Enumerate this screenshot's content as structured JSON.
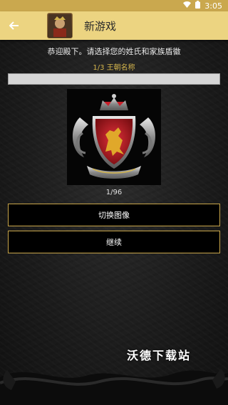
{
  "status_bar": {
    "time": "3:05"
  },
  "app_bar": {
    "title": "新游戏"
  },
  "welcome_text": "恭迎殿下。请选择您的姓氏和家族盾徽",
  "step_label": "1/3 王朝名称",
  "name_field": {
    "value": "",
    "placeholder": ""
  },
  "crest": {
    "index_label": "1/96"
  },
  "buttons": {
    "switch_image": "切换图像",
    "continue": "继续"
  },
  "watermark": "沃德下载站",
  "colors": {
    "status_bar": "#caa84e",
    "app_bar": "#ecd481",
    "accent_gold": "#d4b54c",
    "crest_red": "#c8202a"
  },
  "icons": [
    "wifi-icon",
    "battery-icon",
    "back-arrow-icon",
    "app-icon",
    "crest-image"
  ]
}
